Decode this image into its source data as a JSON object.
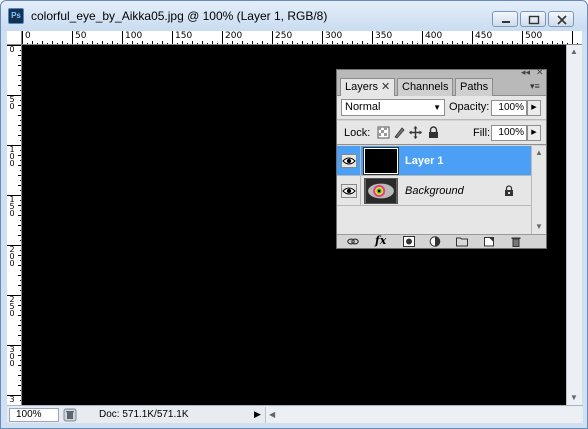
{
  "window": {
    "title": "colorful_eye_by_Aikka05.jpg @ 100% (Layer 1, RGB/8)",
    "app_icon_text": "Ps"
  },
  "ruler_top": [
    "0",
    "50",
    "100",
    "150",
    "200",
    "250",
    "300",
    "350",
    "400",
    "450",
    "500"
  ],
  "ruler_left": [
    "0",
    "5 0",
    "1 0 0",
    "1 5 0",
    "2 0 0",
    "2 5 0",
    "3 0 0",
    "3"
  ],
  "statusbar": {
    "zoom": "100%",
    "doc": "Doc: 571.1K/571.1K"
  },
  "layers_panel": {
    "tabs": [
      {
        "label": "Layers",
        "active": true
      },
      {
        "label": "Channels",
        "active": false
      },
      {
        "label": "Paths",
        "active": false
      }
    ],
    "blend_mode": "Normal",
    "opacity_label": "Opacity:",
    "opacity_value": "100%",
    "lock_label": "Lock:",
    "fill_label": "Fill:",
    "fill_value": "100%",
    "layers": [
      {
        "name": "Layer 1",
        "selected": true,
        "visible": true
      },
      {
        "name": "Background",
        "selected": false,
        "visible": true,
        "locked": true
      }
    ]
  },
  "colors": {
    "selection": "#4ba0f5",
    "canvas": "#000000",
    "titlebar": "#d6e4f4"
  }
}
